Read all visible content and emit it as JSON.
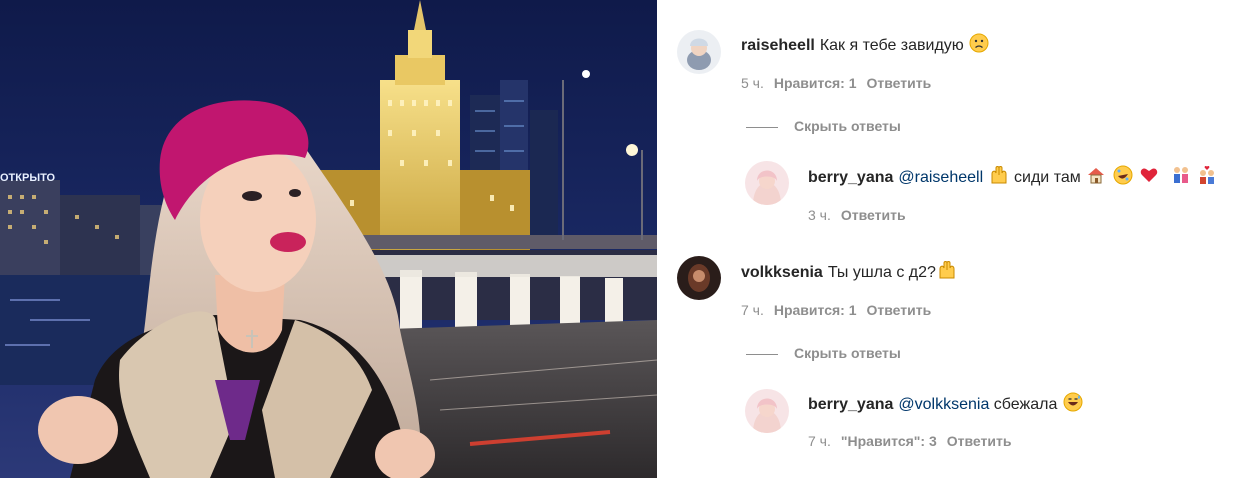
{
  "post": {
    "photo_alt": "",
    "sign_text": "ОТКРЫТО"
  },
  "comments": [
    {
      "username": "raiseheell",
      "text": "Как я тебе завидую",
      "emoji_after": [
        "sad-face"
      ],
      "time": "5 ч.",
      "likes": "Нравится: 1",
      "reply": "Ответить",
      "toggle_label": "Скрыть ответы",
      "replies": [
        {
          "username": "berry_yana",
          "mention": "@raiseheell",
          "text": "сиди там",
          "emoji_before_text": [
            "raised-hands"
          ],
          "emoji_after": [
            "house",
            "rofl-face",
            "red-heart",
            "family",
            "couple-heart"
          ],
          "time": "3 ч.",
          "reply": "Ответить"
        }
      ]
    },
    {
      "username": "volkksenia",
      "text": "Ты ушла с д2?",
      "emoji_after": [
        "raised-hands"
      ],
      "time": "7 ч.",
      "likes": "Нравится: 1",
      "reply": "Ответить",
      "toggle_label": "Скрыть ответы",
      "replies": [
        {
          "username": "berry_yana",
          "mention": "@volkksenia",
          "text": "сбежала",
          "emoji_after": [
            "grinning-sweat-face"
          ],
          "time": "7 ч.",
          "likes": "\"Нравится\": 3",
          "reply": "Ответить"
        }
      ]
    }
  ],
  "colors": {
    "link": "#00376b",
    "meta": "#8e8e8e",
    "text": "#262626"
  }
}
